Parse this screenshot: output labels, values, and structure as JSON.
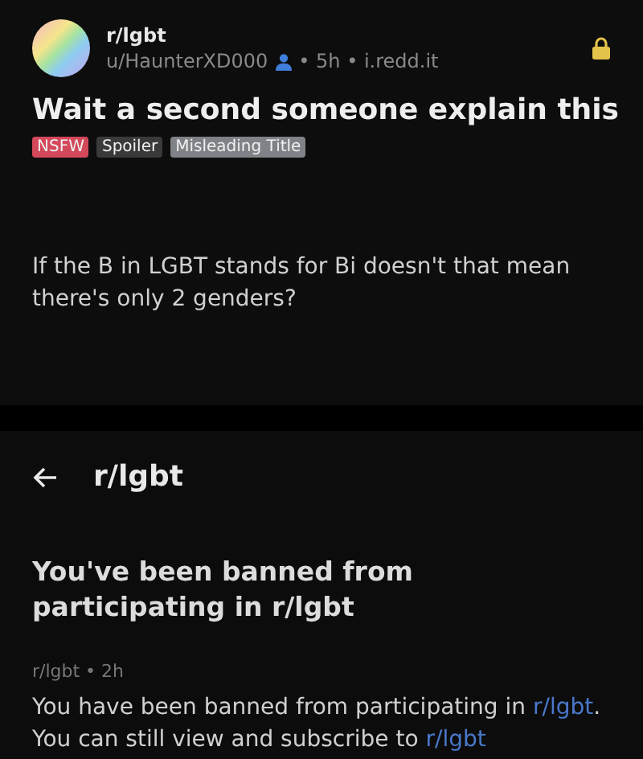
{
  "post": {
    "subreddit": "r/lgbt",
    "author": "u/HaunterXD000",
    "meta": "• 5h • i.redd.it",
    "locked": true,
    "title": "Wait a second someone explain this",
    "flairs": [
      {
        "label": "NSFW",
        "kind": "nsfw"
      },
      {
        "label": "Spoiler",
        "kind": "spoiler"
      },
      {
        "label": "Misleading Title",
        "kind": "flair"
      }
    ],
    "body": "If the B in LGBT stands for Bi doesn't that mean there's only 2 genders?"
  },
  "message_screen": {
    "header": "r/lgbt",
    "title": "You've been banned from participating in r/lgbt",
    "meta": "r/lgbt • 2h",
    "body": [
      {
        "kind": "text",
        "text": "You have been banned from participating in "
      },
      {
        "kind": "link",
        "text": "r/lgbt"
      },
      {
        "kind": "text",
        "text": ". You can still view and subscribe to "
      },
      {
        "kind": "link",
        "text": "r/lgbt"
      }
    ]
  }
}
